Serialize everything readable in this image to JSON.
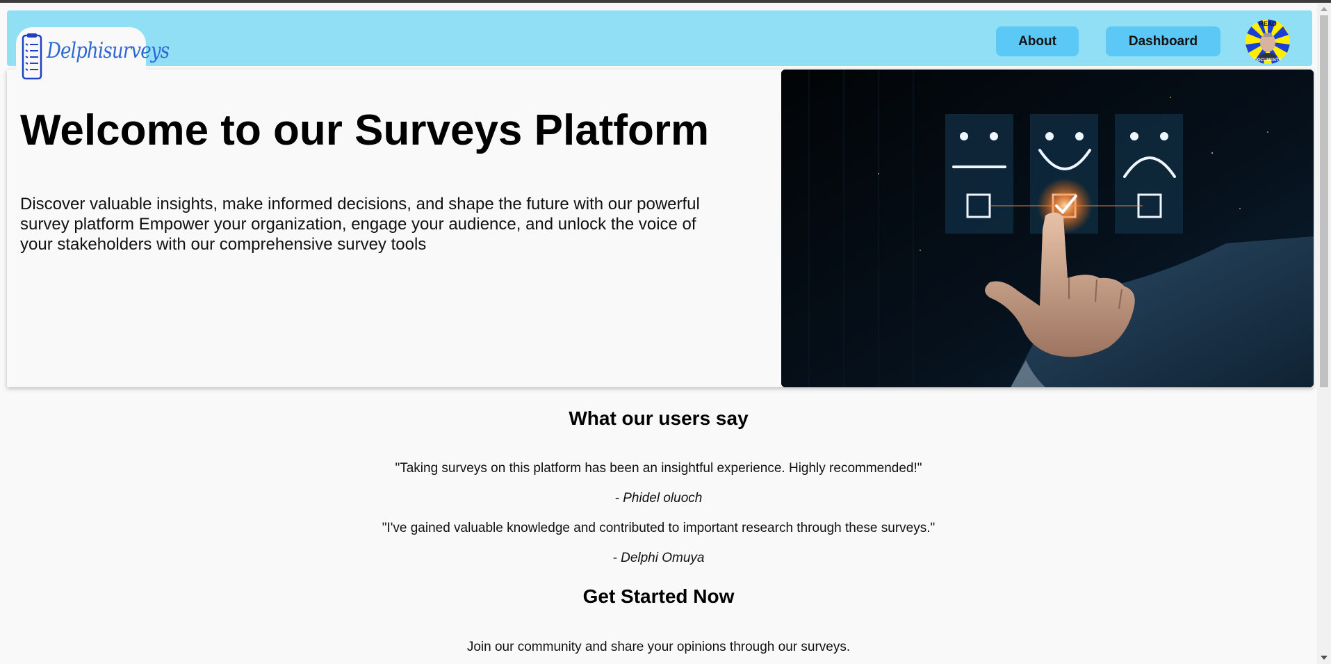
{
  "header": {
    "logo_text": "Delphisurveys",
    "about_label": "About",
    "dashboard_label": "Dashboard",
    "avatar_top_text": "READ",
    "avatar_bottom_text": "DOCUMENTS"
  },
  "hero": {
    "title": "Welcome to our Surveys Platform",
    "description": "Discover valuable insights, make informed decisions, and shape the future with our powerful survey platform Empower your organization, engage your audience, and unlock the voice of your stakeholders with our comprehensive survey tools"
  },
  "testimonials": {
    "title": "What our users say",
    "items": [
      {
        "quote": "\"Taking surveys on this platform has been an insightful experience. Highly recommended!\"",
        "author": "- Phidel oluoch"
      },
      {
        "quote": "\"I've gained valuable knowledge and contributed to important research through these surveys.\"",
        "author": "- Delphi Omuya"
      }
    ]
  },
  "cta": {
    "title": "Get Started Now",
    "text": "Join our community and share your opinions through our surveys."
  },
  "colors": {
    "navbar": "#90dff5",
    "nav_button": "#5bc8f5",
    "logo_text": "#2d66d6",
    "page_background": "#f9f9f9"
  },
  "icons": {
    "logo": "checklist-icon",
    "avatar": "user-avatar"
  }
}
